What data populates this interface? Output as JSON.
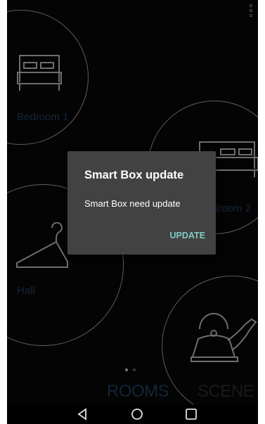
{
  "rooms": [
    {
      "label": "Bedroom 1",
      "icon": "bed-icon"
    },
    {
      "label": "droom 2",
      "icon": "bed-icon"
    },
    {
      "label": "Hall",
      "icon": "hanger-icon"
    },
    {
      "label": "",
      "icon": "kettle-icon"
    }
  ],
  "tabs": {
    "rooms": "ROOMS",
    "scene": "SCENE"
  },
  "pager": {
    "page_count": 2,
    "active_index": 0
  },
  "dialog": {
    "title": "Smart Box update",
    "message": "Smart Box need update",
    "action_label": "UPDATE"
  },
  "colors": {
    "dialog_bg": "#424242",
    "accent": "#80cbc4",
    "background": "#040404",
    "circle_stroke": "#5d5d5d",
    "label_text": "#14253a"
  },
  "navbar": {
    "icons": [
      "back-icon",
      "home-icon",
      "recents-icon"
    ]
  }
}
